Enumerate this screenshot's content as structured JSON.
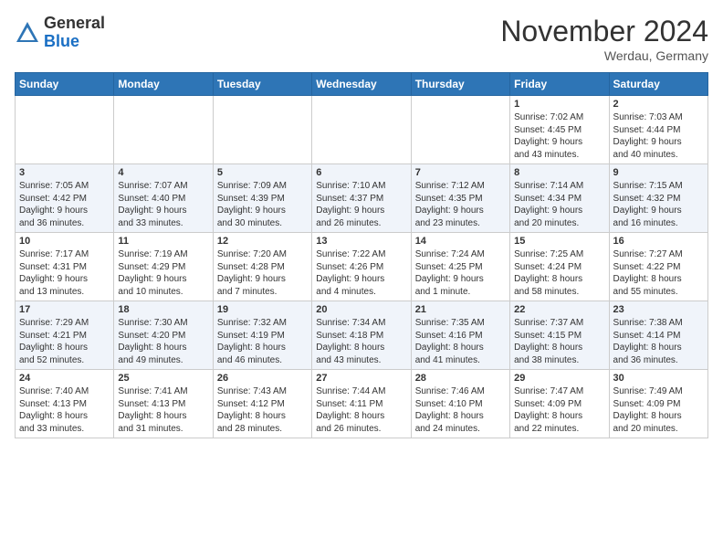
{
  "header": {
    "logo_general": "General",
    "logo_blue": "Blue",
    "month_title": "November 2024",
    "location": "Werdau, Germany"
  },
  "calendar": {
    "days_of_week": [
      "Sunday",
      "Monday",
      "Tuesday",
      "Wednesday",
      "Thursday",
      "Friday",
      "Saturday"
    ],
    "weeks": [
      [
        {
          "day": "",
          "info": ""
        },
        {
          "day": "",
          "info": ""
        },
        {
          "day": "",
          "info": ""
        },
        {
          "day": "",
          "info": ""
        },
        {
          "day": "",
          "info": ""
        },
        {
          "day": "1",
          "info": "Sunrise: 7:02 AM\nSunset: 4:45 PM\nDaylight: 9 hours\nand 43 minutes."
        },
        {
          "day": "2",
          "info": "Sunrise: 7:03 AM\nSunset: 4:44 PM\nDaylight: 9 hours\nand 40 minutes."
        }
      ],
      [
        {
          "day": "3",
          "info": "Sunrise: 7:05 AM\nSunset: 4:42 PM\nDaylight: 9 hours\nand 36 minutes."
        },
        {
          "day": "4",
          "info": "Sunrise: 7:07 AM\nSunset: 4:40 PM\nDaylight: 9 hours\nand 33 minutes."
        },
        {
          "day": "5",
          "info": "Sunrise: 7:09 AM\nSunset: 4:39 PM\nDaylight: 9 hours\nand 30 minutes."
        },
        {
          "day": "6",
          "info": "Sunrise: 7:10 AM\nSunset: 4:37 PM\nDaylight: 9 hours\nand 26 minutes."
        },
        {
          "day": "7",
          "info": "Sunrise: 7:12 AM\nSunset: 4:35 PM\nDaylight: 9 hours\nand 23 minutes."
        },
        {
          "day": "8",
          "info": "Sunrise: 7:14 AM\nSunset: 4:34 PM\nDaylight: 9 hours\nand 20 minutes."
        },
        {
          "day": "9",
          "info": "Sunrise: 7:15 AM\nSunset: 4:32 PM\nDaylight: 9 hours\nand 16 minutes."
        }
      ],
      [
        {
          "day": "10",
          "info": "Sunrise: 7:17 AM\nSunset: 4:31 PM\nDaylight: 9 hours\nand 13 minutes."
        },
        {
          "day": "11",
          "info": "Sunrise: 7:19 AM\nSunset: 4:29 PM\nDaylight: 9 hours\nand 10 minutes."
        },
        {
          "day": "12",
          "info": "Sunrise: 7:20 AM\nSunset: 4:28 PM\nDaylight: 9 hours\nand 7 minutes."
        },
        {
          "day": "13",
          "info": "Sunrise: 7:22 AM\nSunset: 4:26 PM\nDaylight: 9 hours\nand 4 minutes."
        },
        {
          "day": "14",
          "info": "Sunrise: 7:24 AM\nSunset: 4:25 PM\nDaylight: 9 hours\nand 1 minute."
        },
        {
          "day": "15",
          "info": "Sunrise: 7:25 AM\nSunset: 4:24 PM\nDaylight: 8 hours\nand 58 minutes."
        },
        {
          "day": "16",
          "info": "Sunrise: 7:27 AM\nSunset: 4:22 PM\nDaylight: 8 hours\nand 55 minutes."
        }
      ],
      [
        {
          "day": "17",
          "info": "Sunrise: 7:29 AM\nSunset: 4:21 PM\nDaylight: 8 hours\nand 52 minutes."
        },
        {
          "day": "18",
          "info": "Sunrise: 7:30 AM\nSunset: 4:20 PM\nDaylight: 8 hours\nand 49 minutes."
        },
        {
          "day": "19",
          "info": "Sunrise: 7:32 AM\nSunset: 4:19 PM\nDaylight: 8 hours\nand 46 minutes."
        },
        {
          "day": "20",
          "info": "Sunrise: 7:34 AM\nSunset: 4:18 PM\nDaylight: 8 hours\nand 43 minutes."
        },
        {
          "day": "21",
          "info": "Sunrise: 7:35 AM\nSunset: 4:16 PM\nDaylight: 8 hours\nand 41 minutes."
        },
        {
          "day": "22",
          "info": "Sunrise: 7:37 AM\nSunset: 4:15 PM\nDaylight: 8 hours\nand 38 minutes."
        },
        {
          "day": "23",
          "info": "Sunrise: 7:38 AM\nSunset: 4:14 PM\nDaylight: 8 hours\nand 36 minutes."
        }
      ],
      [
        {
          "day": "24",
          "info": "Sunrise: 7:40 AM\nSunset: 4:13 PM\nDaylight: 8 hours\nand 33 minutes."
        },
        {
          "day": "25",
          "info": "Sunrise: 7:41 AM\nSunset: 4:13 PM\nDaylight: 8 hours\nand 31 minutes."
        },
        {
          "day": "26",
          "info": "Sunrise: 7:43 AM\nSunset: 4:12 PM\nDaylight: 8 hours\nand 28 minutes."
        },
        {
          "day": "27",
          "info": "Sunrise: 7:44 AM\nSunset: 4:11 PM\nDaylight: 8 hours\nand 26 minutes."
        },
        {
          "day": "28",
          "info": "Sunrise: 7:46 AM\nSunset: 4:10 PM\nDaylight: 8 hours\nand 24 minutes."
        },
        {
          "day": "29",
          "info": "Sunrise: 7:47 AM\nSunset: 4:09 PM\nDaylight: 8 hours\nand 22 minutes."
        },
        {
          "day": "30",
          "info": "Sunrise: 7:49 AM\nSunset: 4:09 PM\nDaylight: 8 hours\nand 20 minutes."
        }
      ]
    ]
  }
}
